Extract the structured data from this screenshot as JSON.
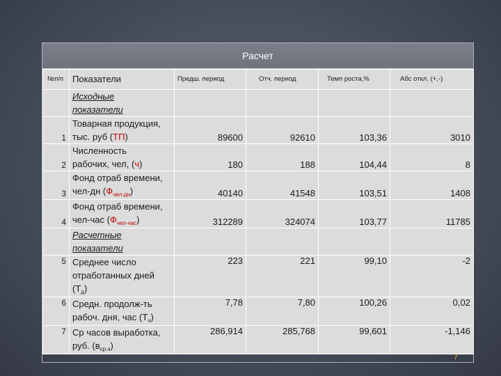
{
  "title": "Расчет",
  "columns": {
    "no": "№п/п",
    "indicator": "Показатели",
    "prev": "Предш. период",
    "report": "Отч. период",
    "growth": "Темп роста,%",
    "abs": "Абс откл. (+,-)"
  },
  "section_initial": [
    "Исходные",
    "показатели"
  ],
  "section_calc": [
    "Расчетные",
    "показатели"
  ],
  "rows": [
    {
      "no": "1",
      "line1": "Товарная продукция,",
      "line2_pre": "тыс. руб (",
      "line2_red": "ТП",
      "line2_post": ")",
      "prev": "89600",
      "report": "92610",
      "growth": "103,36",
      "abs": "3010"
    },
    {
      "no": "2",
      "line1": "Численность",
      "line2_pre": "рабочих, чел, (",
      "line2_red": "ч",
      "line2_post": ")",
      "prev": "180",
      "report": "188",
      "growth": "104,44",
      "abs": "8"
    },
    {
      "no": "3",
      "line1": "Фонд отраб времени,",
      "line2_pre": "чел-дн (",
      "line2_red": "Ф",
      "line2_sub": "чел-дн",
      "line2_post": ")",
      "prev": "40140",
      "report": "41548",
      "growth": "103,51",
      "abs": "1408"
    },
    {
      "no": "4",
      "line1": "Фонд отраб времени,",
      "line2_pre": "чел-час (",
      "line2_red": "Ф",
      "line2_sub": "чел-час",
      "line2_post": ")",
      "prev": "312289",
      "report": "324074",
      "growth": "103,77",
      "abs": "11785"
    },
    {
      "no": "5",
      "line1": "Среднее число",
      "line2": "отработанных дней",
      "line3_pre": "(Т",
      "line3_sub": "д",
      "line3_post": ")",
      "prev": "223",
      "report": "221",
      "growth": "99,10",
      "abs": "-2"
    },
    {
      "no": "6",
      "line1": "Средн. продолж-ть",
      "line2_pre": "рабоч. дня, час (Т",
      "line2_sub": "ч",
      "line2_post": ")",
      "prev": "7,78",
      "report": "7,80",
      "growth": "100,26",
      "abs": "0,02"
    },
    {
      "no": "7",
      "line1": "Ср часов выработка,",
      "line2_pre": "руб. (в",
      "line2_sub": "ср.ч",
      "line2_post": ")",
      "prev": "286,914",
      "report": "285,768",
      "growth": "99,601",
      "abs": "-1,146"
    }
  ],
  "page_number": "7"
}
